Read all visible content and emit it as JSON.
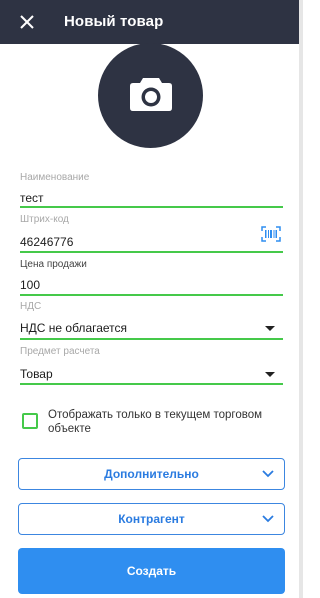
{
  "header": {
    "title": "Новый товар",
    "close_icon": "close-icon",
    "background": "#2e3343"
  },
  "photo": {
    "icon": "camera-icon"
  },
  "form": {
    "name": {
      "label": "Наименование",
      "value": "тест"
    },
    "barcode": {
      "label": "Штрих-код",
      "value": "46246776",
      "icon": "barcode-scan-icon"
    },
    "price": {
      "label": "Цена продажи",
      "value": "100"
    },
    "vat": {
      "label": "НДС",
      "value": "НДС не облагается"
    },
    "subject": {
      "label": "Предмет расчета",
      "value": "Товар"
    },
    "accent_color": "#45c94a"
  },
  "checkbox": {
    "label": "Отображать только в текущем торговом объекте",
    "checked": false
  },
  "sections": {
    "additional": {
      "label": "Дополнительно"
    },
    "counterparty": {
      "label": "Контрагент"
    },
    "border_color": "#3c86e0"
  },
  "actions": {
    "create_label": "Создать",
    "create_color": "#2f8ef0"
  }
}
